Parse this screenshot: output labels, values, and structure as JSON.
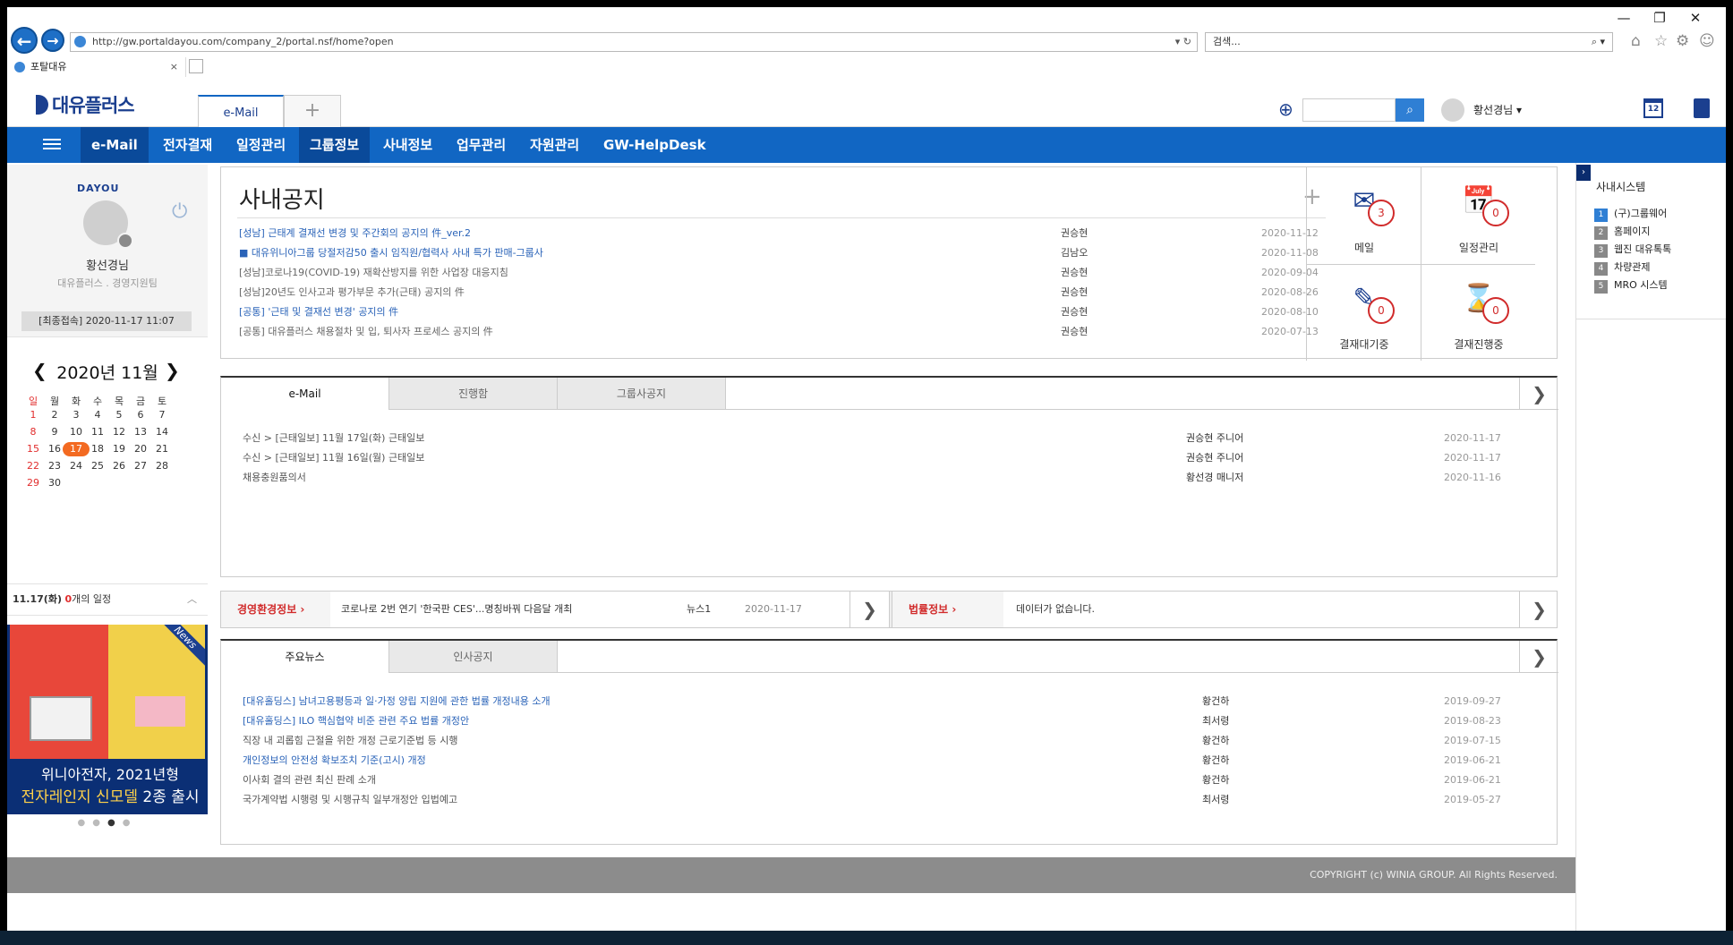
{
  "browser": {
    "url": "http://gw.portaldayou.com/company_2/portal.nsf/home?open",
    "search_placeholder": "검색...",
    "tab_title": "포탈대유",
    "tab_close": "×"
  },
  "header": {
    "logo": "대유플러스",
    "active_tab": "e-Mail",
    "add_tab": "+",
    "user_name": "황선경님",
    "calendar_day": "12"
  },
  "nav": {
    "items": [
      "e-Mail",
      "전자결재",
      "일정관리",
      "그룹정보",
      "사내정보",
      "업무관리",
      "자원관리",
      "GW-HelpDesk"
    ]
  },
  "profile": {
    "brand": "DAYOU",
    "name": "황선경님",
    "org": "대유플러스 . 경영지원팀",
    "last_login": "[최종접속] 2020-11-17 11:07"
  },
  "calendar": {
    "title": "2020년 11월",
    "weekdays": [
      "일",
      "월",
      "화",
      "수",
      "목",
      "금",
      "토"
    ],
    "today": "17"
  },
  "schedule": {
    "date": "11.17(화)",
    "count": "0",
    "suffix": "개의 일정"
  },
  "banner": {
    "badge": "News",
    "line1": "위니아전자, 2021년형",
    "line2a": "전자레인지 신모델",
    "line2b": " 2종 출시"
  },
  "notice": {
    "title": "사내공지",
    "plus": "+",
    "rows": [
      {
        "title": "[성남] 근태계 결재선 변경 및 주간회의 공지의 件_ver.2",
        "author": "권승현",
        "date": "2020-11-12",
        "blue": true
      },
      {
        "title": "■ 대유위니아그룹 당절저감50 출시 임직원/협력사 사내 특가 판매-그룹사",
        "author": "김남오",
        "date": "2020-11-08",
        "blue": true
      },
      {
        "title": "[성남]코로나19(COVID-19) 재확산방지를 위한 사업장 대응지침",
        "author": "권승현",
        "date": "2020-09-04",
        "blue": false
      },
      {
        "title": "[성남]20년도 인사고과 평가부문 추가(근태) 공지의 件",
        "author": "권승현",
        "date": "2020-08-26",
        "blue": false
      },
      {
        "title": "[공통] '근태 및 결재선 변경' 공지의 件",
        "author": "권승현",
        "date": "2020-08-10",
        "blue": true
      },
      {
        "title": "[공통] 대유플러스 채용절차 및 입, 퇴사자 프로세스 공지의 件",
        "author": "권승현",
        "date": "2020-07-13",
        "blue": false
      }
    ]
  },
  "quick": [
    {
      "label": "메일",
      "count": "3"
    },
    {
      "label": "일정관리",
      "count": "0"
    },
    {
      "label": "결재대기중",
      "count": "0"
    },
    {
      "label": "결재진행중",
      "count": "0"
    }
  ],
  "mail": {
    "tabs": [
      "e-Mail",
      "진행함",
      "그룹사공지"
    ],
    "rows": [
      {
        "title": "수신 > [근태일보] 11월 17일(화) 근태일보",
        "from": "권승현 주니어",
        "date": "2020-11-17"
      },
      {
        "title": "수신 > [근태일보] 11월 16일(월) 근태일보",
        "from": "권승현 주니어",
        "date": "2020-11-17"
      },
      {
        "title": "채용충원품의서",
        "from": "황선경 매니저",
        "date": "2020-11-16"
      }
    ]
  },
  "ticker": {
    "left_label": "경영환경정보",
    "left_text": "코로나로 2번 연기 '한국판 CES'...명칭바꿔 다음달 개최",
    "left_source": "뉴스1",
    "left_date": "2020-11-17",
    "right_label": "법률정보",
    "right_text": "데이터가 없습니다."
  },
  "news": {
    "tabs": [
      "주요뉴스",
      "인사공지"
    ],
    "rows": [
      {
        "title": "[대유홀딩스] 남녀고용평등과 일·가정 양립 지원에 관한 법률 개정내용 소개",
        "author": "황건하",
        "date": "2019-09-27",
        "blue": true
      },
      {
        "title": "[대유홀딩스] ILO 핵심협약 비준 관련 주요 법률 개정안",
        "author": "최서령",
        "date": "2019-08-23",
        "blue": true
      },
      {
        "title": "직장 내 괴롭힘 근절을 위한 개정 근로기준법 등 시행",
        "author": "황건하",
        "date": "2019-07-15",
        "blue": false
      },
      {
        "title": "개인정보의 안전성 확보조치 기준(고시) 개정",
        "author": "황건하",
        "date": "2019-06-21",
        "blue": true
      },
      {
        "title": "이사회 결의 관련 최신 판례 소개",
        "author": "황건하",
        "date": "2019-06-21",
        "blue": false
      },
      {
        "title": "국가계약법 시행령 및 시행규칙 일부개정안 입법예고",
        "author": "최서령",
        "date": "2019-05-27",
        "blue": false
      }
    ]
  },
  "right": {
    "title": "사내시스템",
    "items": [
      "(구)그룹웨어",
      "홈페이지",
      "웹진 대유톡톡",
      "차량관제",
      "MRO 시스템"
    ]
  },
  "footer": "COPYRIGHT (c) WINIA GROUP. All Rights Reserved."
}
